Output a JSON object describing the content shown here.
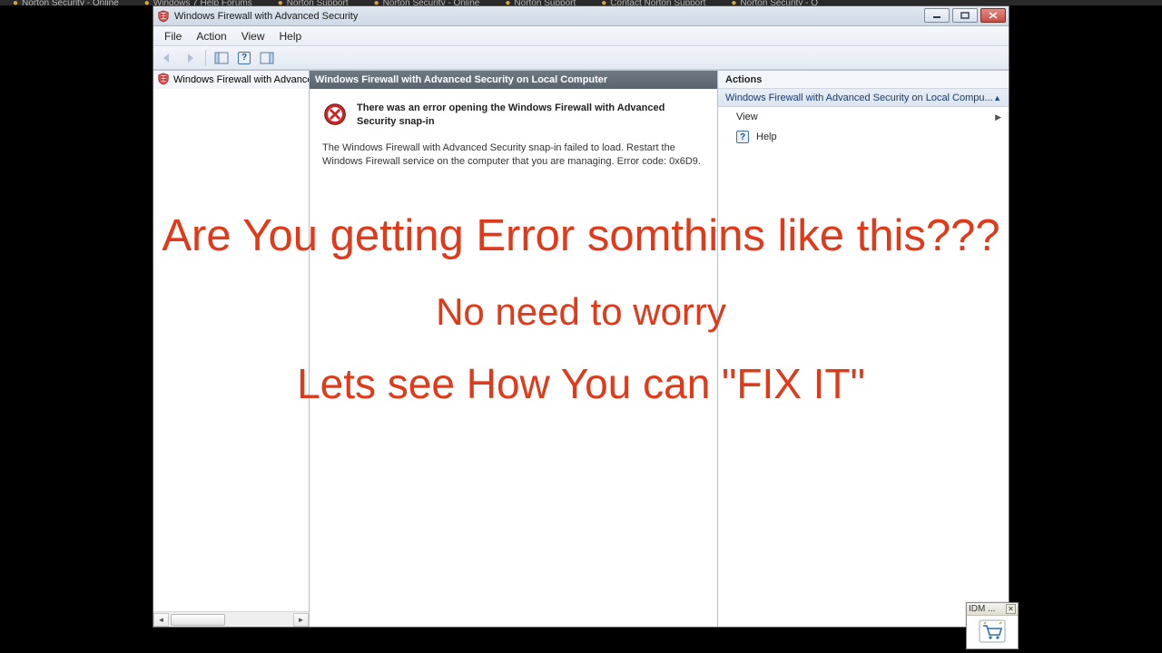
{
  "browser_tabs": [
    "Norton Security - Online",
    "Windows 7 Help Forums",
    "Norton Support",
    "Norton Security - Online",
    "Norton Support",
    "Contact Norton Support",
    "Norton Security - O"
  ],
  "window": {
    "title": "Windows Firewall with Advanced Security"
  },
  "menubar": {
    "items": [
      "File",
      "Action",
      "View",
      "Help"
    ]
  },
  "left_pane": {
    "root": "Windows Firewall with Advance"
  },
  "center_pane": {
    "header": "Windows Firewall with Advanced Security on Local Computer",
    "error_title": "There was an error opening the Windows Firewall with Advanced Security snap-in",
    "error_body": "The Windows Firewall with Advanced Security snap-in failed to load.  Restart the Windows Firewall service on the computer that you are managing. Error code: 0x6D9."
  },
  "actions_pane": {
    "header": "Actions",
    "group": "Windows Firewall with Advanced Security on Local Compu...",
    "items": {
      "view": "View",
      "help": "Help"
    }
  },
  "overlay": {
    "line1": "Are You getting Error somthins like this???",
    "line2": "No need to worry",
    "line3": "Lets see How You can \"FIX IT\""
  },
  "idm": {
    "title": "IDM ..."
  }
}
